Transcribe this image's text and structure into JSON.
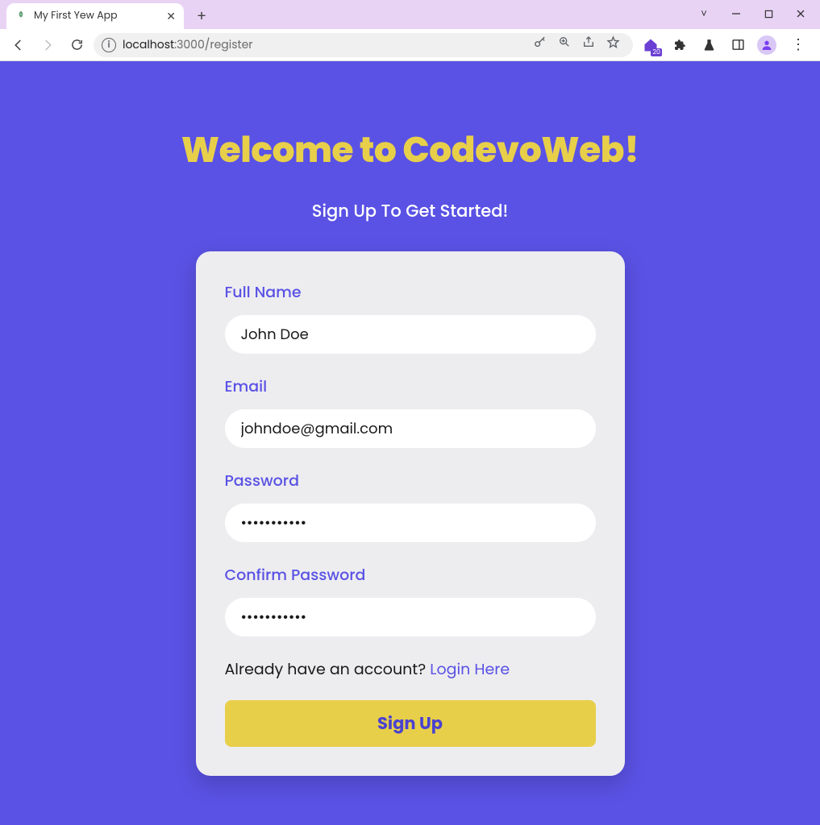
{
  "browser": {
    "tab_title": "My First Yew App",
    "url_host": "localhost",
    "url_port_path": ":3000/register"
  },
  "page": {
    "heading": "Welcome to CodevoWeb!",
    "subheading": "Sign Up To Get Started!"
  },
  "form": {
    "fullname": {
      "label": "Full Name",
      "value": "John Doe"
    },
    "email": {
      "label": "Email",
      "value": "johndoe@gmail.com"
    },
    "password": {
      "label": "Password",
      "value": "•••••••••••"
    },
    "confirm": {
      "label": "Confirm Password",
      "value": "•••••••••••"
    },
    "login_prompt": "Already have an account? ",
    "login_link": "Login Here",
    "submit_label": "Sign Up"
  },
  "ext_badge": "20",
  "colors": {
    "page_bg": "#5a52e4",
    "heading": "#e8cf4a",
    "card_bg": "#ededf0",
    "accent": "#5a52e4",
    "button_bg": "#e8cf4a",
    "button_text": "#4a42d0"
  }
}
